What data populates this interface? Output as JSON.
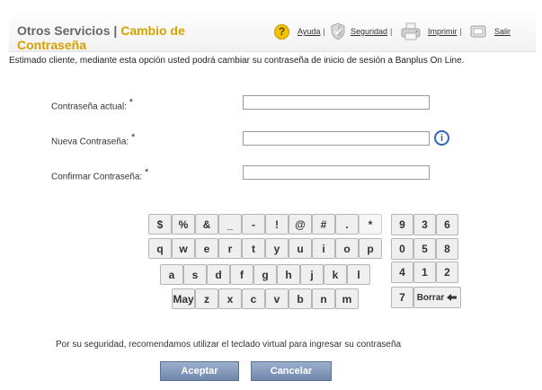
{
  "header": {
    "section": "Otros Servicios",
    "separator": "|",
    "current_page": "Cambio de Contraseña"
  },
  "toolbar": {
    "help": {
      "icon": "help-icon",
      "glyph": "?",
      "label": "Ayuda"
    },
    "security": {
      "icon": "shield-icon",
      "label": "Seguridad"
    },
    "print": {
      "icon": "printer-icon",
      "label": "Imprimir"
    },
    "exit": {
      "icon": "exit-icon",
      "label": "Salir"
    },
    "separator": "|"
  },
  "intro_text": "Estimado cliente, mediante esta opción usted podrá cambiar su contraseña de inicio de sesión a Banplus On Line.",
  "form": {
    "required_mark": "*",
    "current_password": {
      "label": "Contraseña actual:",
      "value": ""
    },
    "new_password": {
      "label": "Nueva Contraseña:",
      "value": ""
    },
    "confirm_password": {
      "label": "Confirmar Contraseña:",
      "value": ""
    },
    "info_icon": "i"
  },
  "keyboard": {
    "rows": [
      [
        "$",
        "%",
        "&",
        "_",
        "-",
        "!",
        "@",
        "#",
        ".",
        "*"
      ],
      [
        "q",
        "w",
        "e",
        "r",
        "t",
        "y",
        "u",
        "i",
        "o",
        "p"
      ],
      [
        "a",
        "s",
        "d",
        "f",
        "g",
        "h",
        "j",
        "k",
        "l"
      ],
      [
        "May",
        "z",
        "x",
        "c",
        "v",
        "b",
        "n",
        "m"
      ]
    ],
    "numpad": [
      "9",
      "3",
      "6",
      "0",
      "5",
      "8",
      "4",
      "1",
      "2",
      "7"
    ],
    "delete_label": "Borrar",
    "delete_icon": "backspace-arrow-icon"
  },
  "security_note": "Por su seguridad, recomendamos utilizar el teclado virtual para ingresar su contraseña",
  "buttons": {
    "accept": "Aceptar",
    "cancel": "Cancelar"
  },
  "colors": {
    "accent_gold": "#d6a200",
    "title_gray": "#666666",
    "button_blue": "#7187ab",
    "info_blue": "#2f66b5"
  }
}
